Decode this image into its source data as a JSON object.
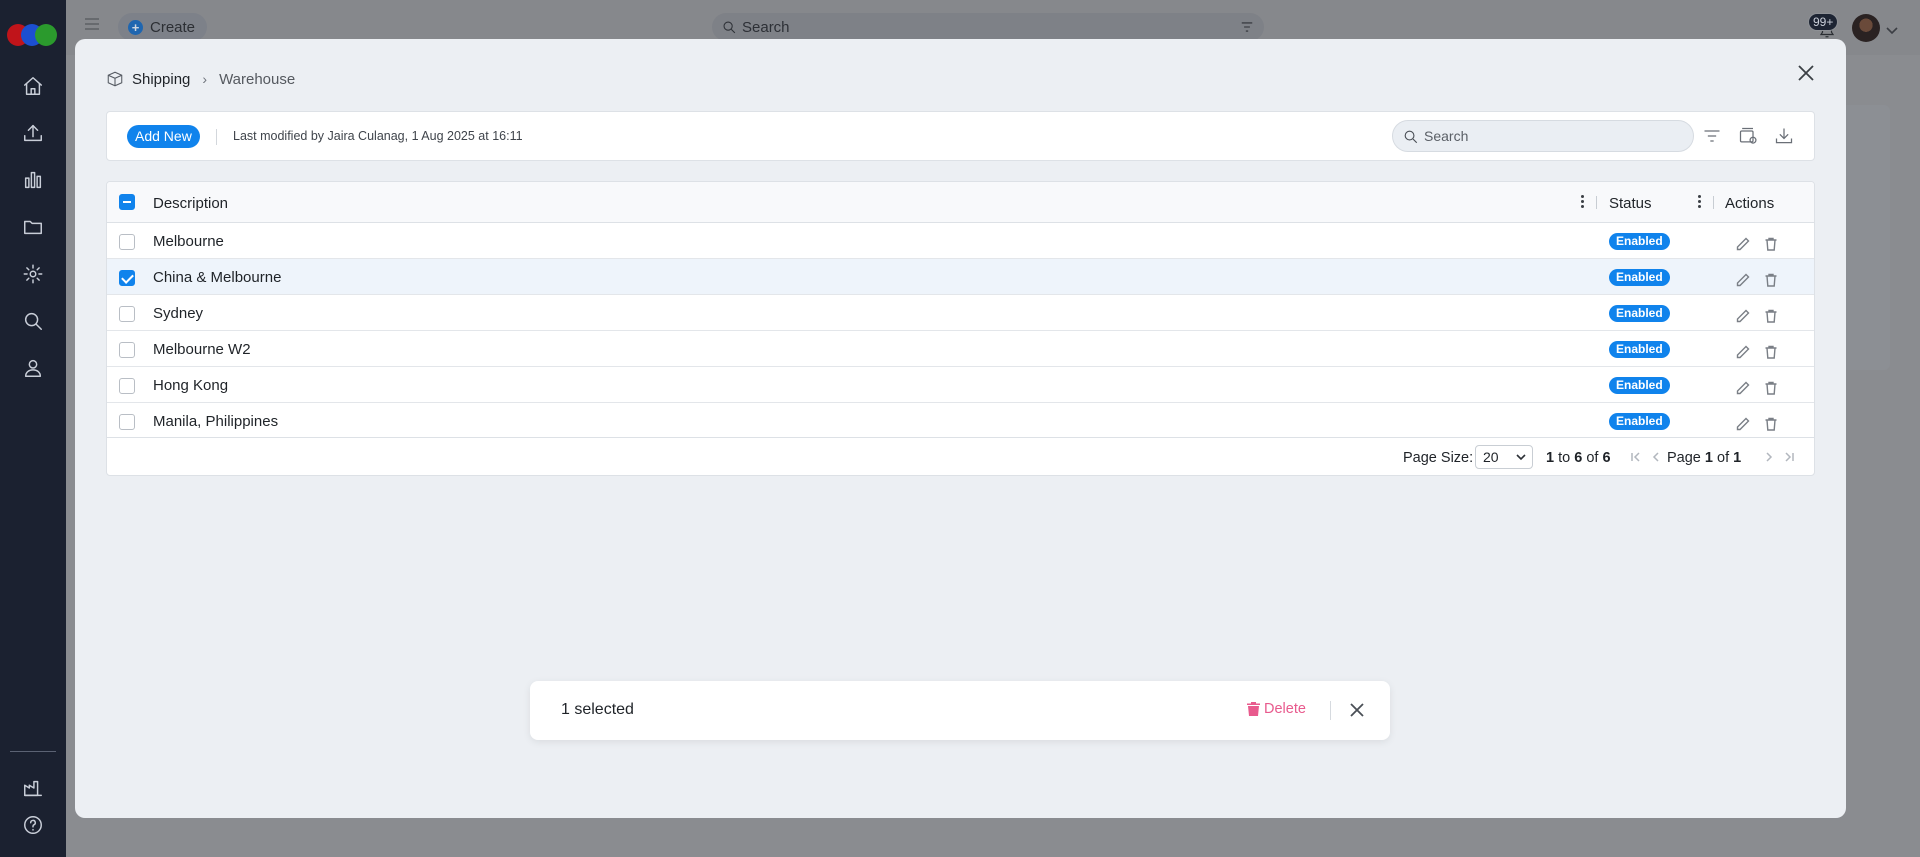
{
  "topbar": {
    "create_label": "Create",
    "search_placeholder": "Search",
    "notifications_badge": "99+"
  },
  "modal": {
    "breadcrumb": {
      "section": "Shipping",
      "page": "Warehouse"
    },
    "toolbar": {
      "add_new_label": "Add New",
      "last_modified": "Last modified by Jaira Culanag, 1 Aug 2025 at 16:11",
      "search_placeholder": "Search"
    },
    "grid": {
      "columns": {
        "description": "Description",
        "status": "Status",
        "actions": "Actions"
      },
      "rows": [
        {
          "description": "Melbourne",
          "status": "Enabled",
          "selected": false
        },
        {
          "description": "China & Melbourne",
          "status": "Enabled",
          "selected": true
        },
        {
          "description": "Sydney",
          "status": "Enabled",
          "selected": false
        },
        {
          "description": "Melbourne W2",
          "status": "Enabled",
          "selected": false
        },
        {
          "description": "Hong Kong",
          "status": "Enabled",
          "selected": false
        },
        {
          "description": "Manila, Philippines",
          "status": "Enabled",
          "selected": false
        }
      ],
      "pager": {
        "page_size_label": "Page Size:",
        "page_size_value": "20",
        "range_prefix": "1",
        "range_to": "to",
        "range_end": "6",
        "range_of": "of",
        "range_total": "6",
        "page_prefix": "Page",
        "page_current": "1",
        "page_of": "of",
        "page_total": "1"
      }
    },
    "selection_bar": {
      "count_label": "1 selected",
      "delete_label": "Delete"
    }
  },
  "colors": {
    "accent": "#1083ec",
    "danger": "#e85a8d",
    "sidebar": "#1b2130"
  }
}
